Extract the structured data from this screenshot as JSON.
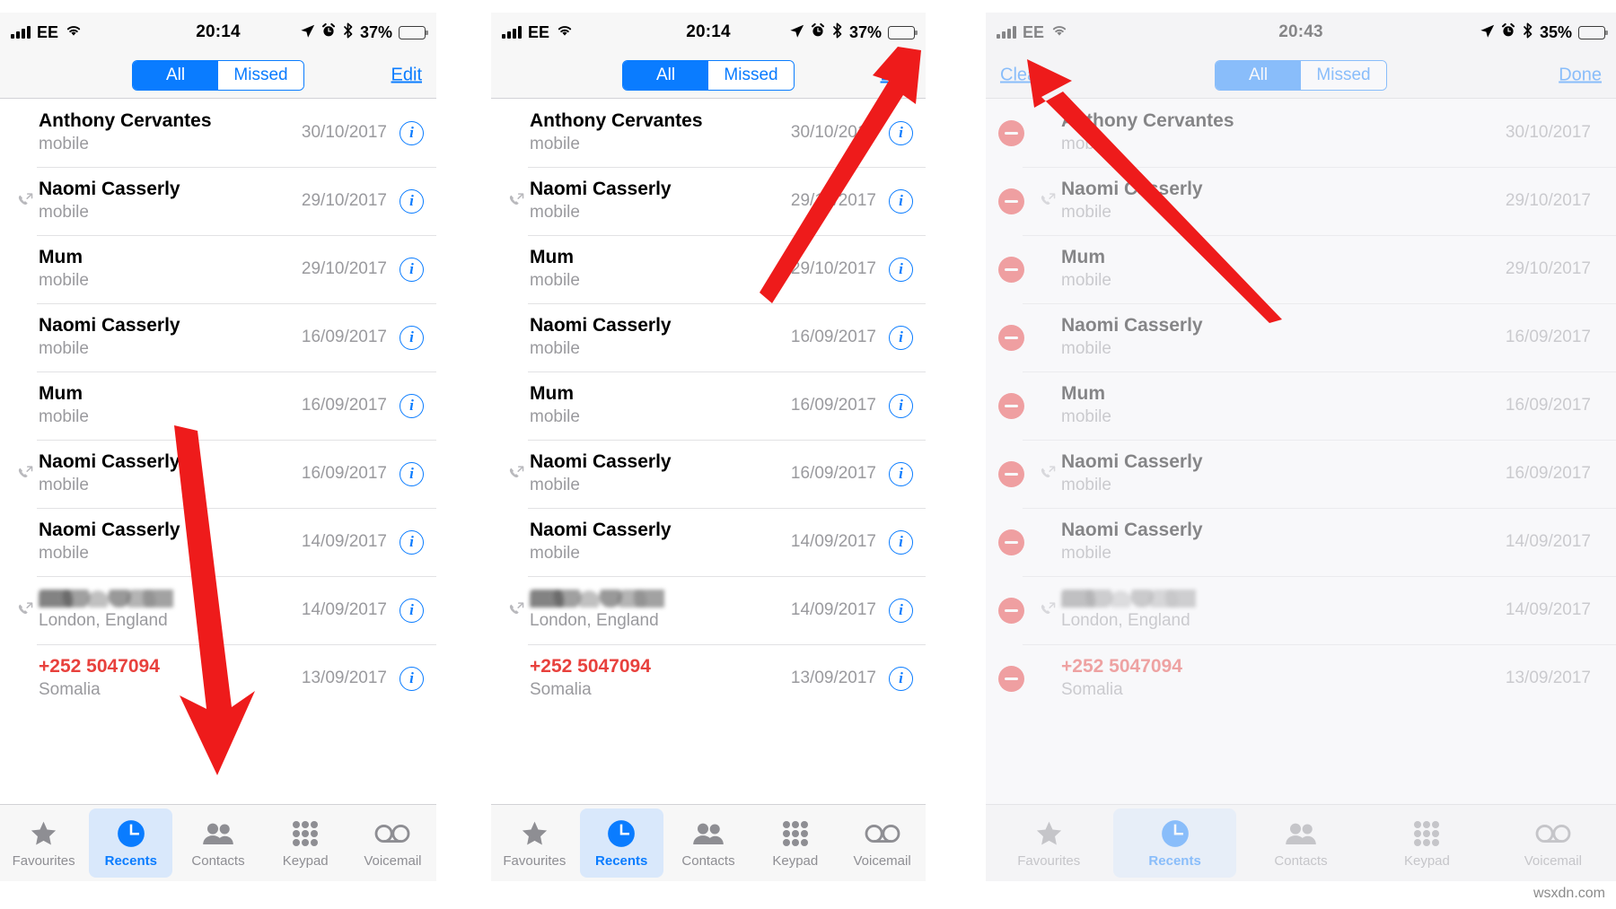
{
  "panels": [
    {
      "id": "panel-1",
      "status": {
        "carrier": "EE",
        "time": "20:14",
        "battery_percent": "37%",
        "battery_level": 37,
        "icons": [
          "signal-bars-icon",
          "wifi-icon",
          "location-arrow-icon",
          "alarm-clock-icon",
          "bluetooth-icon",
          "battery-icon"
        ]
      },
      "nav": {
        "segments": [
          {
            "label": "All",
            "active": true
          },
          {
            "label": "Missed",
            "active": false
          }
        ],
        "right_link": "Edit",
        "left_link": ""
      },
      "rows": [
        {
          "name": "Anthony Cervantes",
          "subtitle": "mobile",
          "date": "30/10/2017",
          "direction": "none",
          "missed": false,
          "redacted": false
        },
        {
          "name": "Naomi Casserly",
          "subtitle": "mobile",
          "date": "29/10/2017",
          "direction": "outgoing",
          "missed": false,
          "redacted": false
        },
        {
          "name": "Mum",
          "subtitle": "mobile",
          "date": "29/10/2017",
          "direction": "none",
          "missed": false,
          "redacted": false
        },
        {
          "name": "Naomi Casserly",
          "subtitle": "mobile",
          "date": "16/09/2017",
          "direction": "none",
          "missed": false,
          "redacted": false
        },
        {
          "name": "Mum",
          "subtitle": "mobile",
          "date": "16/09/2017",
          "direction": "none",
          "missed": false,
          "redacted": false
        },
        {
          "name": "Naomi Casserly",
          "subtitle": "mobile",
          "date": "16/09/2017",
          "direction": "outgoing",
          "missed": false,
          "redacted": false
        },
        {
          "name": "Naomi Casserly",
          "subtitle": "mobile",
          "date": "14/09/2017",
          "direction": "none",
          "missed": false,
          "redacted": false
        },
        {
          "name": "",
          "subtitle": "London, England",
          "date": "14/09/2017",
          "direction": "outgoing",
          "missed": false,
          "redacted": true
        },
        {
          "name": "+252 5047094",
          "subtitle": "Somalia",
          "date": "13/09/2017",
          "direction": "none",
          "missed": true,
          "redacted": false
        }
      ],
      "edit_mode": false
    },
    {
      "id": "panel-2",
      "status": {
        "carrier": "EE",
        "time": "20:14",
        "battery_percent": "37%",
        "battery_level": 37,
        "icons": [
          "signal-bars-icon",
          "wifi-icon",
          "location-arrow-icon",
          "alarm-clock-icon",
          "bluetooth-icon",
          "battery-icon"
        ]
      },
      "nav": {
        "segments": [
          {
            "label": "All",
            "active": true
          },
          {
            "label": "Missed",
            "active": false
          }
        ],
        "right_link": "Edit",
        "left_link": ""
      },
      "rows": [
        {
          "name": "Anthony Cervantes",
          "subtitle": "mobile",
          "date": "30/10/2017",
          "direction": "none",
          "missed": false,
          "redacted": false
        },
        {
          "name": "Naomi Casserly",
          "subtitle": "mobile",
          "date": "29/10/2017",
          "direction": "outgoing",
          "missed": false,
          "redacted": false
        },
        {
          "name": "Mum",
          "subtitle": "mobile",
          "date": "29/10/2017",
          "direction": "none",
          "missed": false,
          "redacted": false
        },
        {
          "name": "Naomi Casserly",
          "subtitle": "mobile",
          "date": "16/09/2017",
          "direction": "none",
          "missed": false,
          "redacted": false
        },
        {
          "name": "Mum",
          "subtitle": "mobile",
          "date": "16/09/2017",
          "direction": "none",
          "missed": false,
          "redacted": false
        },
        {
          "name": "Naomi Casserly",
          "subtitle": "mobile",
          "date": "16/09/2017",
          "direction": "outgoing",
          "missed": false,
          "redacted": false
        },
        {
          "name": "Naomi Casserly",
          "subtitle": "mobile",
          "date": "14/09/2017",
          "direction": "none",
          "missed": false,
          "redacted": false
        },
        {
          "name": "",
          "subtitle": "London, England",
          "date": "14/09/2017",
          "direction": "outgoing",
          "missed": false,
          "redacted": true
        },
        {
          "name": "+252 5047094",
          "subtitle": "Somalia",
          "date": "13/09/2017",
          "direction": "none",
          "missed": true,
          "redacted": false
        }
      ],
      "edit_mode": false
    },
    {
      "id": "panel-3",
      "status": {
        "carrier": "EE",
        "time": "20:43",
        "battery_percent": "35%",
        "battery_level": 35,
        "icons": [
          "signal-bars-icon",
          "wifi-icon",
          "location-arrow-icon",
          "alarm-clock-icon",
          "bluetooth-icon",
          "battery-icon"
        ]
      },
      "nav": {
        "segments": [
          {
            "label": "All",
            "active": true
          },
          {
            "label": "Missed",
            "active": false
          }
        ],
        "right_link": "Done",
        "left_link": "Clear"
      },
      "rows": [
        {
          "name": "Anthony Cervantes",
          "subtitle": "mobile",
          "date": "30/10/2017",
          "direction": "none",
          "missed": false,
          "redacted": false
        },
        {
          "name": "Naomi Casserly",
          "subtitle": "mobile",
          "date": "29/10/2017",
          "direction": "outgoing",
          "missed": false,
          "redacted": false
        },
        {
          "name": "Mum",
          "subtitle": "mobile",
          "date": "29/10/2017",
          "direction": "none",
          "missed": false,
          "redacted": false
        },
        {
          "name": "Naomi Casserly",
          "subtitle": "mobile",
          "date": "16/09/2017",
          "direction": "none",
          "missed": false,
          "redacted": false
        },
        {
          "name": "Mum",
          "subtitle": "mobile",
          "date": "16/09/2017",
          "direction": "none",
          "missed": false,
          "redacted": false
        },
        {
          "name": "Naomi Casserly",
          "subtitle": "mobile",
          "date": "16/09/2017",
          "direction": "outgoing",
          "missed": false,
          "redacted": false
        },
        {
          "name": "Naomi Casserly",
          "subtitle": "mobile",
          "date": "14/09/2017",
          "direction": "none",
          "missed": false,
          "redacted": false
        },
        {
          "name": "",
          "subtitle": "London, England",
          "date": "14/09/2017",
          "direction": "outgoing",
          "missed": false,
          "redacted": true
        },
        {
          "name": "+252 5047094",
          "subtitle": "Somalia",
          "date": "13/09/2017",
          "direction": "none",
          "missed": true,
          "redacted": false
        }
      ],
      "edit_mode": true
    }
  ],
  "tabbar": {
    "items": [
      {
        "label": "Favourites",
        "icon": "star-icon",
        "active": false
      },
      {
        "label": "Recents",
        "icon": "clock-icon",
        "active": true
      },
      {
        "label": "Contacts",
        "icon": "people-icon",
        "active": false
      },
      {
        "label": "Keypad",
        "icon": "keypad-icon",
        "active": false
      },
      {
        "label": "Voicemail",
        "icon": "voicemail-icon",
        "active": false
      }
    ]
  },
  "annotations": [
    {
      "name": "arrow-to-recents-tab",
      "target": "Recents tab (panel 1)"
    },
    {
      "name": "arrow-to-edit-button",
      "target": "Edit link (panel 2)"
    },
    {
      "name": "arrow-to-clear-button",
      "target": "Clear link (panel 3)"
    }
  ],
  "watermark": "wsxdn.com",
  "colors": {
    "accent_blue": "#0a7cff",
    "missed_red": "#e8413d",
    "delete_red": "#ec3b3b",
    "arrow_red": "#ee1b1b",
    "bar_grey": "#f7f7f7",
    "separator": "#e2e2e4",
    "muted_text": "#9a9a9e",
    "tab_inactive": "#8e8e93",
    "tab_active_bg": "#d9e8fb"
  }
}
